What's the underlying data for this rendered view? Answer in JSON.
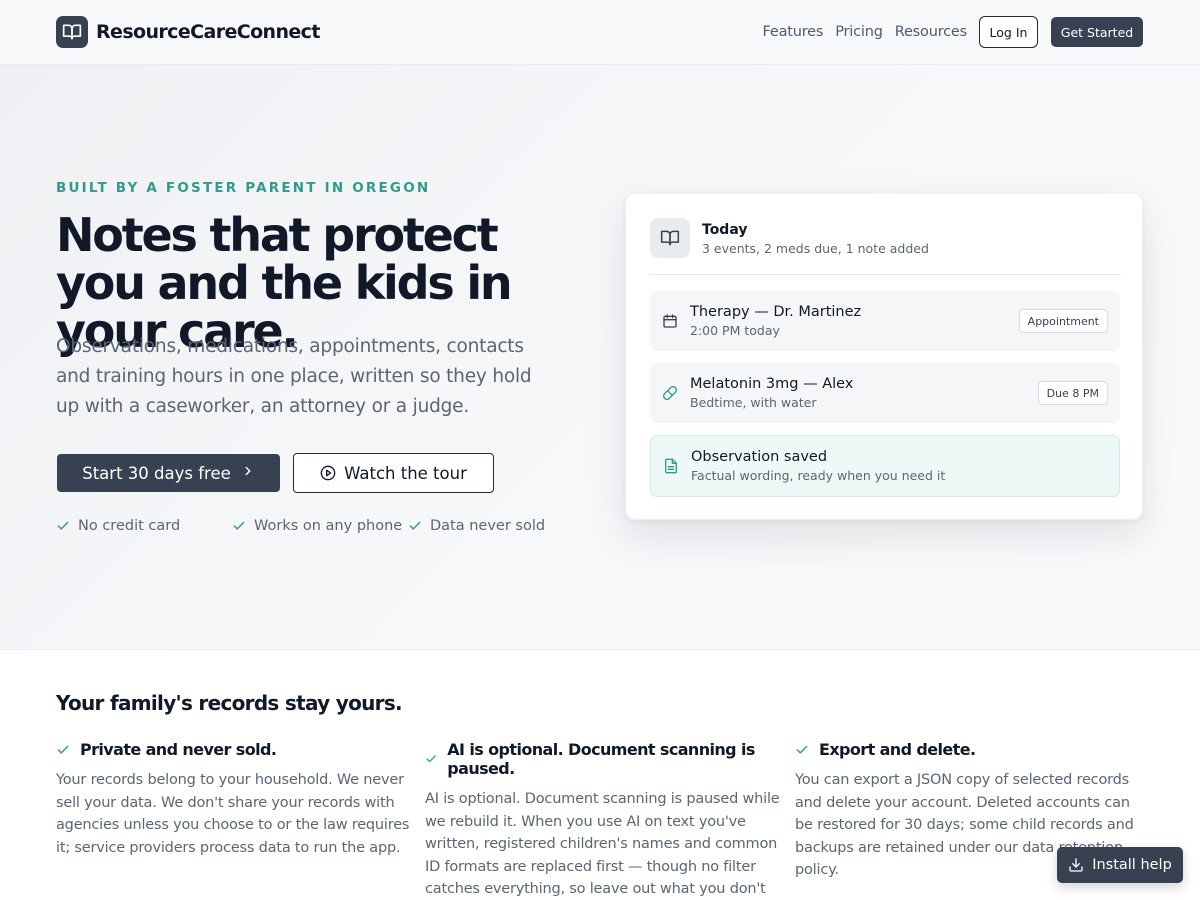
{
  "header": {
    "brand_name": "ResourceCareConnect",
    "nav": [
      "Features",
      "Pricing",
      "Resources"
    ],
    "login_label": "Log In",
    "get_started_label": "Get Started"
  },
  "hero": {
    "eyebrow": "BUILT BY A FOSTER PARENT IN OREGON",
    "headline": "Notes that protect you and the kids in your care.",
    "subtext": "Observations, medications, appointments, contacts and training hours in one place, written so they hold up with a caseworker, an attorney or a judge.",
    "primary_cta": "Start 30 days free",
    "secondary_cta": "Watch the tour",
    "checks": [
      "No credit card",
      "Works on any phone",
      "Data never sold"
    ]
  },
  "card": {
    "title": "Today",
    "subtitle": "3 events, 2 meds due, 1 note added",
    "items": [
      {
        "icon": "calendar-icon",
        "title": "Therapy — Dr. Martinez",
        "detail": "2:00 PM today",
        "badge": "Appointment"
      },
      {
        "icon": "pill-icon",
        "title": "Melatonin 3mg — Alex",
        "detail": "Bedtime, with water",
        "badge": "Due 8 PM"
      },
      {
        "icon": "document-icon",
        "title": "Observation saved",
        "detail": "Factual wording, ready when you need it",
        "badge": ""
      }
    ]
  },
  "features": {
    "title": "Your family's records stay yours.",
    "items": [
      {
        "title": "Private and never sold.",
        "body": "Your records belong to your household. We never sell your data. We don't share your records with agencies unless you choose to or the law requires it; service providers process data to run the app."
      },
      {
        "title": "AI is optional. Document scanning is paused.",
        "body": "AI is optional. Document scanning is paused while we rebuild it. When you use AI on text you've written, registered children's names and common ID formats are replaced first — though no filter catches everything, so leave out what you don't want processed."
      },
      {
        "title": "Export and delete.",
        "body": "You can export a JSON copy of selected records and delete your account. Deleted accounts can be restored for 30 days; some child records and backups are retained under our data retention policy."
      }
    ]
  },
  "install_help": "Install help",
  "colors": {
    "accent": "#2d9c8a",
    "primary": "#374151",
    "text": "#111827",
    "muted": "#5b6573"
  }
}
